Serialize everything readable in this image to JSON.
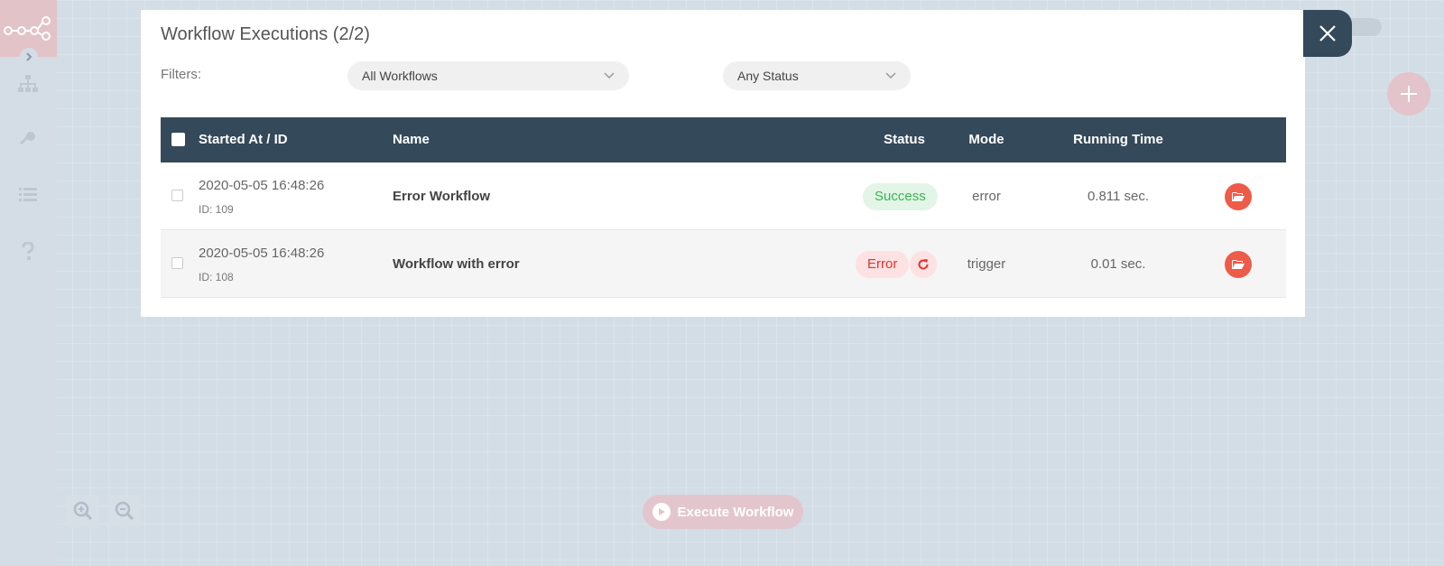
{
  "modal": {
    "title": "Workflow Executions (2/2)",
    "filters_label": "Filters:",
    "workflow_filter": {
      "selected": "All Workflows"
    },
    "status_filter": {
      "selected": "Any Status"
    }
  },
  "table": {
    "columns": {
      "started": "Started At / ID",
      "name": "Name",
      "status": "Status",
      "mode": "Mode",
      "running_time": "Running Time"
    },
    "rows": [
      {
        "started": "2020-05-05 16:48:26",
        "id": "ID: 109",
        "name": "Error Workflow",
        "status": "Success",
        "mode": "error",
        "running_time": "0.811 sec."
      },
      {
        "started": "2020-05-05 16:48:26",
        "id": "ID: 108",
        "name": "Workflow with error",
        "status": "Error",
        "mode": "trigger",
        "running_time": "0.01 sec."
      }
    ]
  },
  "background": {
    "execute_button_label": "Execute Workflow"
  },
  "colors": {
    "header_bg": "#34495a",
    "success_text": "#3ab44e",
    "error_text": "#e0342b",
    "action_red": "#ee5b48"
  },
  "icons": [
    "n8n-logo-icon",
    "chevron-right-icon",
    "network-icon",
    "key-icon",
    "list-icon",
    "question-icon",
    "plus-icon",
    "zoom-in-icon",
    "zoom-out-icon",
    "play-icon",
    "close-icon",
    "chevron-down-icon",
    "retry-icon",
    "folder-open-icon"
  ]
}
